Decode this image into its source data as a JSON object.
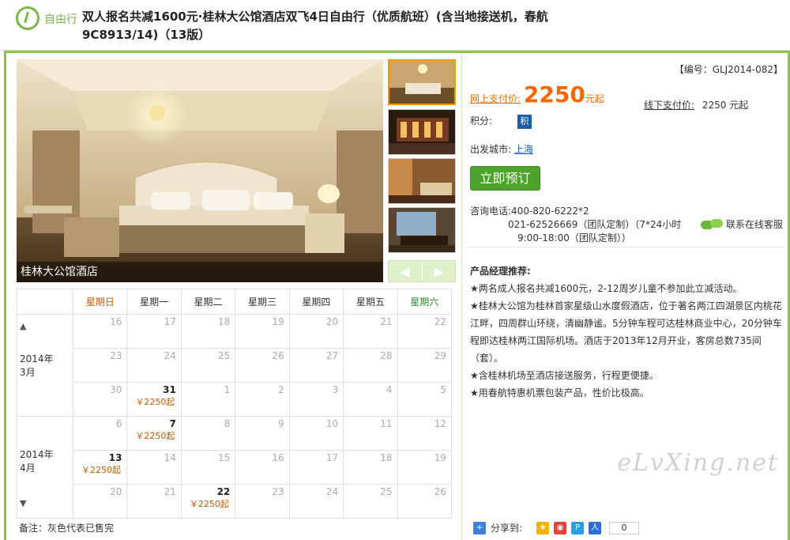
{
  "header": {
    "logo_text": "自由行",
    "title": "双人报名共减1600元·桂林大公馆酒店双飞4日自由行（优质航班）(含当地接送机，春航9C8913/14)（13版）"
  },
  "gallery": {
    "caption": "桂林大公馆酒店",
    "prev": "◀",
    "next": "▶"
  },
  "calendar": {
    "weekdays": [
      "星期日",
      "星期一",
      "星期二",
      "星期三",
      "星期四",
      "星期五",
      "星期六"
    ],
    "up_arrow": "▲",
    "down_arrow": "▼",
    "months": [
      {
        "year": "2014年",
        "month": "3月"
      },
      {
        "year": "2014年",
        "month": "4月"
      }
    ],
    "rows": [
      [
        "16",
        "17",
        "18",
        "19",
        "20",
        "21",
        "22"
      ],
      [
        "23",
        "24",
        "25",
        "26",
        "27",
        "28",
        "29"
      ],
      [
        "30",
        "31",
        "1",
        "2",
        "3",
        "4",
        "5"
      ],
      [
        "6",
        "7",
        "8",
        "9",
        "10",
        "11",
        "12"
      ],
      [
        "13",
        "14",
        "15",
        "16",
        "17",
        "18",
        "19"
      ],
      [
        "20",
        "21",
        "22",
        "23",
        "24",
        "25",
        "26"
      ]
    ],
    "price_label": "￥2250起",
    "footnote": "备注：灰色代表已售完"
  },
  "info": {
    "code": "【编号：GLJ2014-082】",
    "online_label": "网上支付价:",
    "online_price": "2250",
    "online_unit": "元起",
    "offline_label": "线下支付价:",
    "offline_price": "2250 元起",
    "points_label": "积分:",
    "points_badge": "积",
    "city_label": "出发城市:",
    "city": "上海",
    "book_button": "立即预订",
    "phone_label": "咨询电话:",
    "phone1": "400-820-6222*2",
    "phone2": "021-62526669（团队定制）（7*24小时",
    "phone3": "9:00-18:00（团队定制））",
    "online_service": "联系在线客服",
    "rec_title": "产品经理推荐:",
    "recs": [
      "★两名成人报名共减1600元，2-12周岁儿童不参加此立减活动。",
      "★桂林大公馆为桂林首家星级山水度假酒店，位于著名两江四湖景区内桃花江畔，四周群山环绕，清幽静谧。5分钟车程可达桂林商业中心，20分钟车程即达桂林两江国际机场。酒店于2013年12月开业，客房总数735间（套）。",
      "★含桂林机场至酒店接送服务，行程更便捷。",
      "★用春航特惠机票包装产品，性价比极高。"
    ],
    "share_label": "分享到:",
    "share_count": "0"
  },
  "watermark": "eLvXing.net"
}
